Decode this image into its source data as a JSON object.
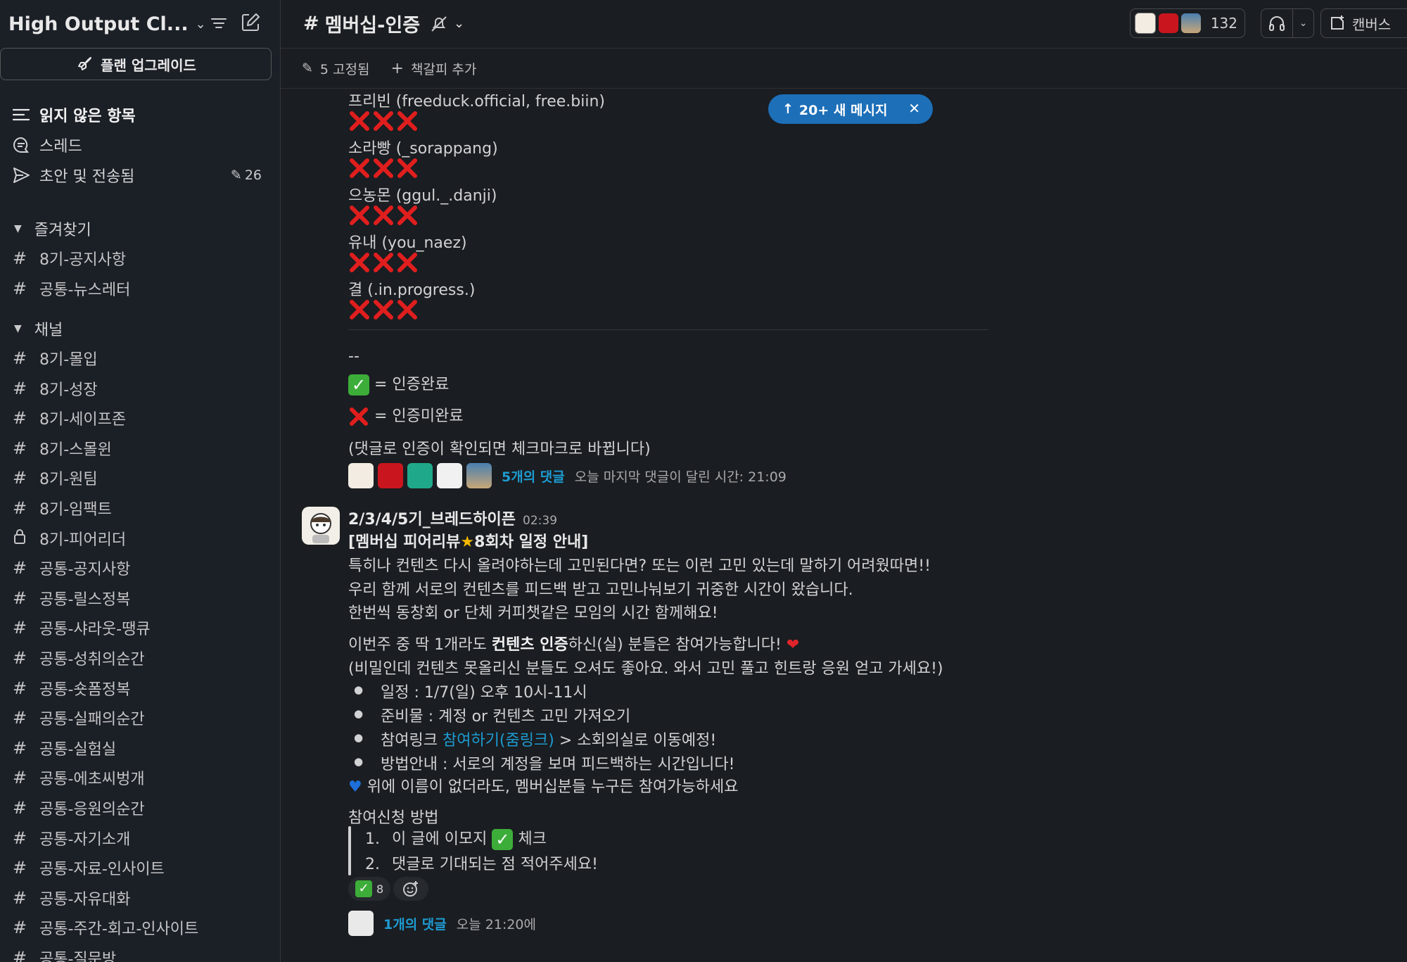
{
  "workspace": {
    "name": "High Output Cl..."
  },
  "sidebar": {
    "upgrade_label": "플랜 업그레이드",
    "nav": [
      {
        "label": "읽지 않은 항목"
      },
      {
        "label": "스레드"
      },
      {
        "label": "초안 및 전송됨",
        "count": "26"
      }
    ],
    "favorites_title": "즐겨찾기",
    "favorites": [
      "8기-공지사항",
      "공통-뉴스레터"
    ],
    "channels_title": "채널",
    "channels": [
      "8기-몰입",
      "8기-성장",
      "8기-세이프존",
      "8기-스몰윈",
      "8기-원팀",
      "8기-임팩트",
      "8기-피어리더",
      "공통-공지사항",
      "공통-릴스정복",
      "공통-샤라웃-땡큐",
      "공통-성취의순간",
      "공통-숏폼정복",
      "공통-실패의순간",
      "공통-실험실",
      "공통-에초씨벙개",
      "공통-응원의순간",
      "공통-자기소개",
      "공통-자료-인사이트",
      "공통-자유대화",
      "공통-주간-회고-인사이트",
      "공통-질문방"
    ]
  },
  "header": {
    "channel_name": "멤버십-인증",
    "member_count": "132",
    "canvas_label": "캔버스"
  },
  "bookmarks": {
    "pinned_label": "5 고정됨",
    "add_label": "책갈피 추가"
  },
  "new_messages_pill": "20+ 새 메시지",
  "message1": {
    "entries": [
      "프리빈 (freeduck.official, free.biin)",
      "소라빵 (_sorappang)",
      "으농몬 (ggul._.danji)",
      "유내 (you_naez)",
      "결 (.in.progress.)"
    ],
    "divider": "--",
    "legend_done": "= 인증완료",
    "legend_notdone": "= 인증미완료",
    "note": "(댓글로 인증이 확인되면 체크마크로 바뀝니다)",
    "replies_label": "5개의 댓글",
    "last_reply": "오늘 마지막 댓글이 달린 시간: 21:09"
  },
  "message2": {
    "author": "2/3/4/5기_브레드하이픈",
    "time": "02:39",
    "title_pre": "[멤버십 피어리뷰",
    "title_post": "8회차 일정 안내]",
    "lines": [
      "특히나 컨텐츠 다시 올려야하는데 고민된다면? 또는 이런 고민 있는데 말하기 어려웠따면!!",
      "우리 함께 서로의 컨텐츠를 피드백 받고 고민나눠보기 귀중한 시간이 왔습니다.",
      "한번씩 동창회 or 단체 커피챗같은 모임의 시간 함께해요!"
    ],
    "line4_pre": "이번주 중 딱 1개라도 ",
    "line4_bold": "컨텐츠 인증",
    "line4_post": "하신(실) 분들은 참여가능합니다!",
    "line5": "(비밀인데 컨텐츠 못올리신 분들도 오셔도 좋아요. 와서 고민 풀고 힌트랑 응원 얻고 가세요!)",
    "bullets": [
      "일정 : 1/7(일) 오후 10시-11시",
      "준비물 : 계정 or 컨텐츠 고민 가져오기"
    ],
    "bullet3_pre": "참여링크 ",
    "bullet3_link": "참여하기(줌링크)",
    "bullet3_post": " > 소회의실로 이동예정!",
    "bullet4": "방법안내 : 서로의 계정을 보며 피드백하는 시간입니다!",
    "heart_line": "위에 이름이 없더라도, 멤버십분들 누구든 참여가능하세요",
    "apply_title": "참여신청 방법",
    "steps": [
      "이 글에 이모지",
      "댓글로 기대되는 점 적어주세요!"
    ],
    "step1_post": "체크",
    "reaction_count": "8",
    "replies_label": "1개의 댓글",
    "reply_time": "오늘 21:20에"
  },
  "colors": {
    "sidebar_bg": "#1b1f26",
    "main_bg": "#1a1d21",
    "accent_blue": "#1d6fb8",
    "link_blue": "#1d9bd1",
    "check_green": "#3dad3a",
    "x_red": "#e01e1e"
  }
}
